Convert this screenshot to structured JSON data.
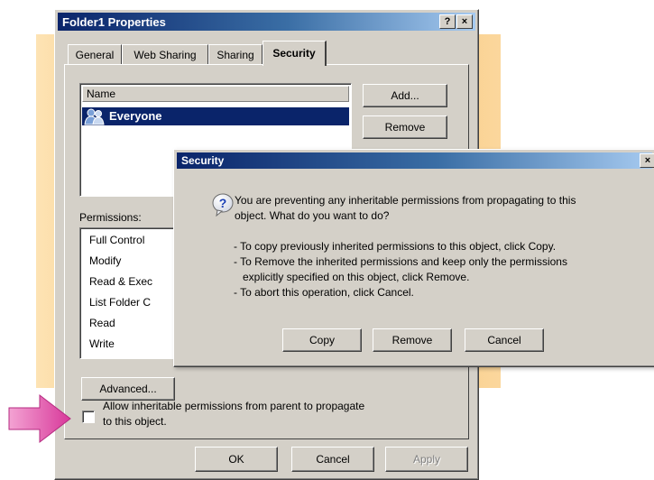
{
  "colors": {
    "titlebar_start": "#0a246a",
    "titlebar_end": "#a6caf0",
    "face": "#d4d0c8",
    "selection": "#0a246a",
    "arrow": "#e04fa8",
    "decor_band": "#f7bd62"
  },
  "main_window": {
    "title": "Folder1 Properties",
    "help_label": "?",
    "close_label": "×",
    "tabs": [
      "General",
      "Web Sharing",
      "Sharing",
      "Security"
    ],
    "active_tab": "Security",
    "names_header": "Name",
    "names": [
      {
        "label": "Everyone",
        "icon": "users-group-icon",
        "selected": true
      }
    ],
    "add_label": "Add...",
    "remove_label": "Remove",
    "permissions_label": "Permissions:",
    "permissions": [
      "Full Control",
      "Modify",
      "Read & Exec",
      "List Folder C",
      "Read",
      "Write"
    ],
    "advanced_label": "Advanced...",
    "inherit_checkbox_label_1": "Allow inheritable permissions from parent to propagate",
    "inherit_checkbox_label_2": "to this object.",
    "inherit_checked": false,
    "ok_label": "OK",
    "cancel_label": "Cancel",
    "apply_label": "Apply"
  },
  "security_dialog": {
    "title": "Security",
    "close_label": "×",
    "icon": "question-icon",
    "icon_glyph": "?",
    "message_line_1": "You are preventing any inheritable permissions from propagating to this",
    "message_line_2": "object. What do you want to do?",
    "option_1": "- To copy previously inherited permissions to this object, click Copy.",
    "option_2a": "- To Remove the inherited permissions and keep only the permissions",
    "option_2b": "explicitly specified on this object, click Remove.",
    "option_3": "- To abort this operation, click Cancel.",
    "copy_label": "Copy",
    "remove_label": "Remove",
    "cancel_label": "Cancel"
  }
}
